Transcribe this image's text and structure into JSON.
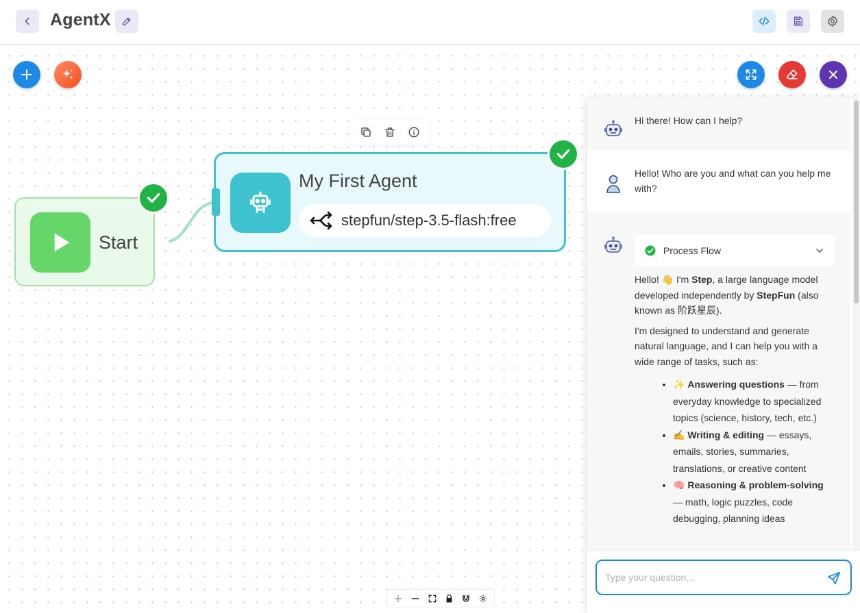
{
  "header": {
    "title": "AgentX"
  },
  "canvas": {
    "start_node": {
      "label": "Start"
    },
    "agent_node": {
      "title": "My First Agent",
      "model": "stepfun/step-3.5-flash:free"
    }
  },
  "chat": {
    "messages": [
      {
        "role": "bot",
        "text": "Hi there! How can I help?"
      },
      {
        "role": "user",
        "text": "Hello! Who are you and what can you help me with?"
      }
    ],
    "process_flow_label": "Process Flow",
    "response": {
      "p1_pre": "Hello! 👋 I'm ",
      "p1_bold1": "Step",
      "p1_mid": ", a large language model developed independently by ",
      "p1_bold2": "StepFun",
      "p1_post": " (also known as 阶跃星辰).",
      "p2": "I'm designed to understand and generate natural language, and I can help you with a wide range of tasks, such as:",
      "items": [
        {
          "emoji": "✨",
          "title": "Answering questions",
          "desc": " — from everyday knowledge to specialized topics (science, history, tech, etc.)"
        },
        {
          "emoji": "✍️",
          "title": "Writing & editing",
          "desc": " — essays, emails, stories, summaries, translations, or creative content"
        },
        {
          "emoji": "🧠",
          "title": "Reasoning & problem-solving",
          "desc": " — math, logic puzzles, code debugging, planning ideas"
        }
      ]
    },
    "input": {
      "placeholder": "Type your question...",
      "value": ""
    }
  },
  "colors": {
    "accent": "#1e88e5",
    "start_green": "#66d56a",
    "agent_teal": "#3fc2cf",
    "check_green": "#21b346",
    "erase_red": "#e53935",
    "close_purple": "#5e35b1"
  },
  "icons": {
    "back": "chevron-left-icon",
    "edit": "pencil-icon",
    "code": "code-icon",
    "save": "save-icon",
    "settings": "gear-icon",
    "add": "plus-icon",
    "magic": "sparkle-icon",
    "expand": "expand-icon",
    "erase": "eraser-icon",
    "close": "close-icon",
    "start": "play-icon",
    "agent": "robot-icon",
    "model": "split-arrow-icon",
    "send": "send-icon"
  }
}
